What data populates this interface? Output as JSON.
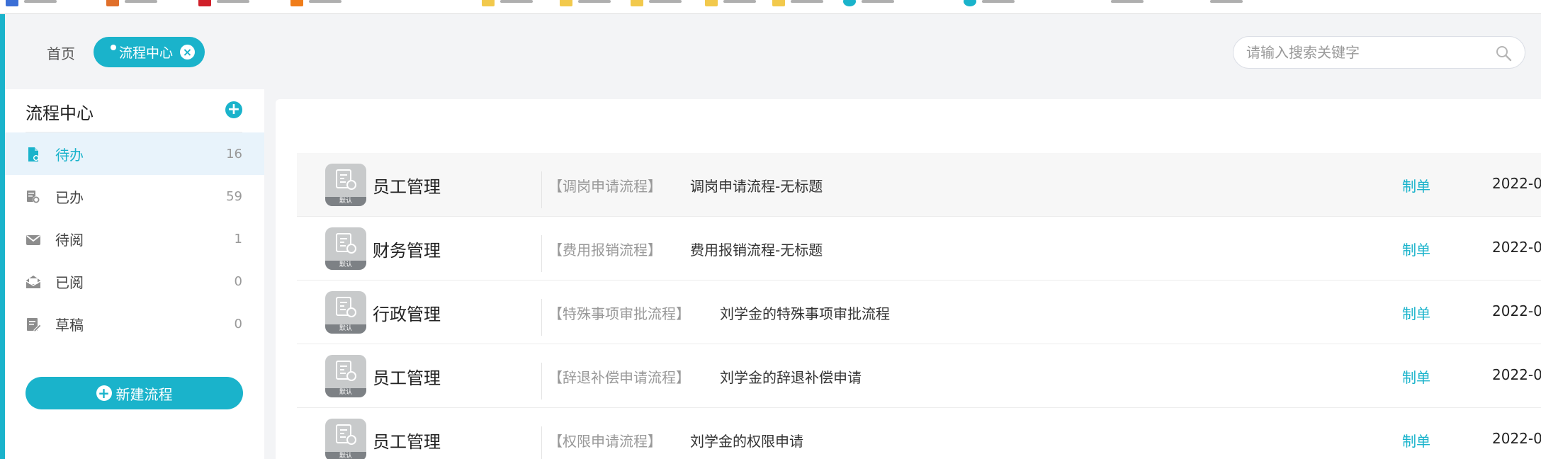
{
  "colors": {
    "accent": "#1ab3cb",
    "active_bg": "#e8f3fb"
  },
  "header": {
    "home_label": "首页",
    "active_tab": "流程中心",
    "search_placeholder": "请输入搜索关键字"
  },
  "sidebar": {
    "title": "流程中心",
    "items": [
      {
        "label": "待办",
        "count": "16",
        "icon": "document-icon",
        "active": true
      },
      {
        "label": "已办",
        "count": "59",
        "icon": "stack-icon",
        "active": false
      },
      {
        "label": "待阅",
        "count": "1",
        "icon": "mail-icon",
        "active": false
      },
      {
        "label": "已阅",
        "count": "0",
        "icon": "open-mail-icon",
        "active": false
      },
      {
        "label": "草稿",
        "count": "0",
        "icon": "draft-icon",
        "active": false
      }
    ],
    "new_button": "新建流程"
  },
  "list": {
    "rows": [
      {
        "badge": "默认",
        "category": "员工管理",
        "flow": "【调岗申请流程】",
        "subject": "调岗申请流程-无标题",
        "action": "制单",
        "date": "2022-0"
      },
      {
        "badge": "默认",
        "category": "财务管理",
        "flow": "【费用报销流程】",
        "subject": "费用报销流程-无标题",
        "action": "制单",
        "date": "2022-0"
      },
      {
        "badge": "默认",
        "category": "行政管理",
        "flow": "【特殊事项审批流程】",
        "subject": "刘学金的特殊事项审批流程",
        "action": "制单",
        "date": "2022-0"
      },
      {
        "badge": "默认",
        "category": "员工管理",
        "flow": "【辞退补偿申请流程】",
        "subject": "刘学金的辞退补偿申请",
        "action": "制单",
        "date": "2022-0"
      },
      {
        "badge": "默认",
        "category": "员工管理",
        "flow": "【权限申请流程】",
        "subject": "刘学金的权限申请",
        "action": "制单",
        "date": "2022-0"
      }
    ]
  }
}
